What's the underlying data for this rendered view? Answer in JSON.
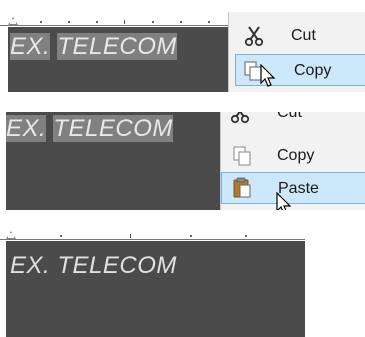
{
  "slide": {
    "text_selected_part_1": "EX.",
    "text_selected_part_2": "TELECOM",
    "text_full": "EX. TELECOM"
  },
  "context_menu_1": {
    "cut_label": "Cut",
    "copy_label": "Copy"
  },
  "context_menu_2": {
    "cut_label": "Cut",
    "copy_label": "Copy",
    "paste_label": "Paste"
  },
  "colors": {
    "slide_bg": "#4b4b4b",
    "highlight": "#cde8fb",
    "highlight_border": "#7ab3d9",
    "menu_bg": "#f2f2f2",
    "text_selection": "#808080"
  },
  "icons": [
    "scissors-icon",
    "copy-icon",
    "paste-icon",
    "mouse-pointer-icon"
  ]
}
